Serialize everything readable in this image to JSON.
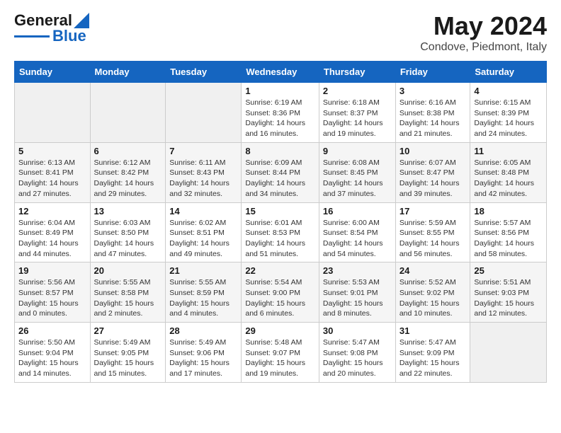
{
  "logo": {
    "line1": "General",
    "line2": "Blue"
  },
  "title": "May 2024",
  "subtitle": "Condove, Piedmont, Italy",
  "days_of_week": [
    "Sunday",
    "Monday",
    "Tuesday",
    "Wednesday",
    "Thursday",
    "Friday",
    "Saturday"
  ],
  "weeks": [
    [
      {
        "day": "",
        "info": ""
      },
      {
        "day": "",
        "info": ""
      },
      {
        "day": "",
        "info": ""
      },
      {
        "day": "1",
        "info": "Sunrise: 6:19 AM\nSunset: 8:36 PM\nDaylight: 14 hours and 16 minutes."
      },
      {
        "day": "2",
        "info": "Sunrise: 6:18 AM\nSunset: 8:37 PM\nDaylight: 14 hours and 19 minutes."
      },
      {
        "day": "3",
        "info": "Sunrise: 6:16 AM\nSunset: 8:38 PM\nDaylight: 14 hours and 21 minutes."
      },
      {
        "day": "4",
        "info": "Sunrise: 6:15 AM\nSunset: 8:39 PM\nDaylight: 14 hours and 24 minutes."
      }
    ],
    [
      {
        "day": "5",
        "info": "Sunrise: 6:13 AM\nSunset: 8:41 PM\nDaylight: 14 hours and 27 minutes."
      },
      {
        "day": "6",
        "info": "Sunrise: 6:12 AM\nSunset: 8:42 PM\nDaylight: 14 hours and 29 minutes."
      },
      {
        "day": "7",
        "info": "Sunrise: 6:11 AM\nSunset: 8:43 PM\nDaylight: 14 hours and 32 minutes."
      },
      {
        "day": "8",
        "info": "Sunrise: 6:09 AM\nSunset: 8:44 PM\nDaylight: 14 hours and 34 minutes."
      },
      {
        "day": "9",
        "info": "Sunrise: 6:08 AM\nSunset: 8:45 PM\nDaylight: 14 hours and 37 minutes."
      },
      {
        "day": "10",
        "info": "Sunrise: 6:07 AM\nSunset: 8:47 PM\nDaylight: 14 hours and 39 minutes."
      },
      {
        "day": "11",
        "info": "Sunrise: 6:05 AM\nSunset: 8:48 PM\nDaylight: 14 hours and 42 minutes."
      }
    ],
    [
      {
        "day": "12",
        "info": "Sunrise: 6:04 AM\nSunset: 8:49 PM\nDaylight: 14 hours and 44 minutes."
      },
      {
        "day": "13",
        "info": "Sunrise: 6:03 AM\nSunset: 8:50 PM\nDaylight: 14 hours and 47 minutes."
      },
      {
        "day": "14",
        "info": "Sunrise: 6:02 AM\nSunset: 8:51 PM\nDaylight: 14 hours and 49 minutes."
      },
      {
        "day": "15",
        "info": "Sunrise: 6:01 AM\nSunset: 8:53 PM\nDaylight: 14 hours and 51 minutes."
      },
      {
        "day": "16",
        "info": "Sunrise: 6:00 AM\nSunset: 8:54 PM\nDaylight: 14 hours and 54 minutes."
      },
      {
        "day": "17",
        "info": "Sunrise: 5:59 AM\nSunset: 8:55 PM\nDaylight: 14 hours and 56 minutes."
      },
      {
        "day": "18",
        "info": "Sunrise: 5:57 AM\nSunset: 8:56 PM\nDaylight: 14 hours and 58 minutes."
      }
    ],
    [
      {
        "day": "19",
        "info": "Sunrise: 5:56 AM\nSunset: 8:57 PM\nDaylight: 15 hours and 0 minutes."
      },
      {
        "day": "20",
        "info": "Sunrise: 5:55 AM\nSunset: 8:58 PM\nDaylight: 15 hours and 2 minutes."
      },
      {
        "day": "21",
        "info": "Sunrise: 5:55 AM\nSunset: 8:59 PM\nDaylight: 15 hours and 4 minutes."
      },
      {
        "day": "22",
        "info": "Sunrise: 5:54 AM\nSunset: 9:00 PM\nDaylight: 15 hours and 6 minutes."
      },
      {
        "day": "23",
        "info": "Sunrise: 5:53 AM\nSunset: 9:01 PM\nDaylight: 15 hours and 8 minutes."
      },
      {
        "day": "24",
        "info": "Sunrise: 5:52 AM\nSunset: 9:02 PM\nDaylight: 15 hours and 10 minutes."
      },
      {
        "day": "25",
        "info": "Sunrise: 5:51 AM\nSunset: 9:03 PM\nDaylight: 15 hours and 12 minutes."
      }
    ],
    [
      {
        "day": "26",
        "info": "Sunrise: 5:50 AM\nSunset: 9:04 PM\nDaylight: 15 hours and 14 minutes."
      },
      {
        "day": "27",
        "info": "Sunrise: 5:49 AM\nSunset: 9:05 PM\nDaylight: 15 hours and 15 minutes."
      },
      {
        "day": "28",
        "info": "Sunrise: 5:49 AM\nSunset: 9:06 PM\nDaylight: 15 hours and 17 minutes."
      },
      {
        "day": "29",
        "info": "Sunrise: 5:48 AM\nSunset: 9:07 PM\nDaylight: 15 hours and 19 minutes."
      },
      {
        "day": "30",
        "info": "Sunrise: 5:47 AM\nSunset: 9:08 PM\nDaylight: 15 hours and 20 minutes."
      },
      {
        "day": "31",
        "info": "Sunrise: 5:47 AM\nSunset: 9:09 PM\nDaylight: 15 hours and 22 minutes."
      },
      {
        "day": "",
        "info": ""
      }
    ]
  ]
}
